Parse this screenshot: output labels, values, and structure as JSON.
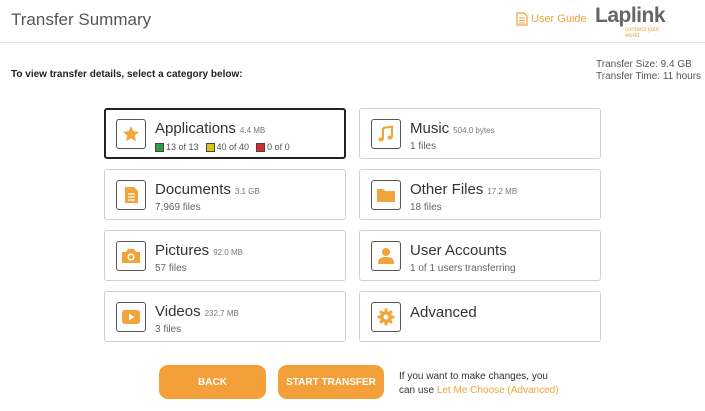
{
  "header": {
    "title": "Transfer Summary",
    "guide_label": "User Guide",
    "logo_text": "Laplink",
    "logo_tag": "connect your world"
  },
  "instruction": "To view transfer details, select a category below:",
  "stats": {
    "size": "Transfer Size: 9.4 GB",
    "time": "Transfer Time: 11 hours"
  },
  "categories": [
    {
      "name": "Applications",
      "size": "4.4 MB",
      "icon": "star-icon",
      "legend": [
        {
          "color": "#2e9e3e",
          "text": "13 of 13"
        },
        {
          "color": "#d9c41c",
          "text": "40 of 40"
        },
        {
          "color": "#d62a2a",
          "text": "0 of 0"
        }
      ]
    },
    {
      "name": "Music",
      "size": "504.0 bytes",
      "sub": "1 files",
      "icon": "music-note-icon"
    },
    {
      "name": "Documents",
      "size": "3.1 GB",
      "sub": "7,969 files",
      "icon": "document-icon"
    },
    {
      "name": "Other Files",
      "size": "17.2 MB",
      "sub": "18 files",
      "icon": "folder-icon"
    },
    {
      "name": "Pictures",
      "size": "92.0 MB",
      "sub": "57 files",
      "icon": "camera-icon"
    },
    {
      "name": "User Accounts",
      "size": "",
      "sub": "1 of 1 users transferring",
      "icon": "user-icon"
    },
    {
      "name": "Videos",
      "size": "232.7 MB",
      "sub": "3 files",
      "icon": "play-icon"
    },
    {
      "name": "Advanced",
      "size": "",
      "sub": "",
      "icon": "gear-icon"
    }
  ],
  "buttons": {
    "back": "BACK",
    "start": "START TRANSFER"
  },
  "note": {
    "line1": "If you want to make changes, you",
    "prefix": "can use ",
    "link": "Let Me Choose (Advanced)"
  },
  "colors": {
    "accent": "#f3a03b",
    "icon": "#f0a43a"
  }
}
